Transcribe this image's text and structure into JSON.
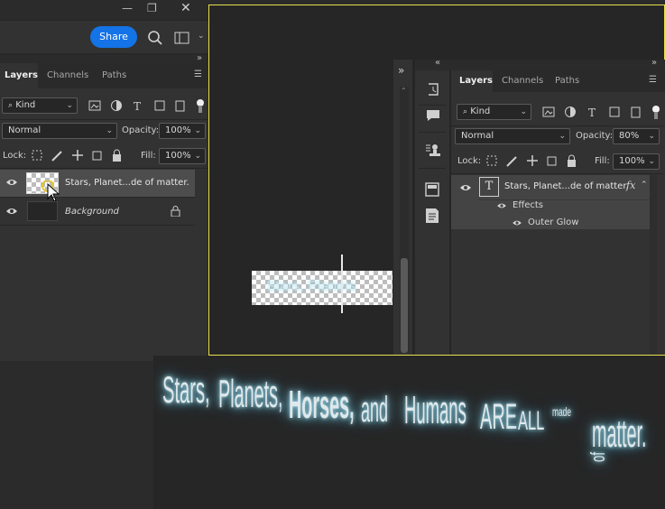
{
  "window": {
    "minimize": "—",
    "restore": "❐",
    "close": "✕"
  },
  "header": {
    "share_label": "Share"
  },
  "left_panel": {
    "tabs": [
      "Layers",
      "Channels",
      "Paths"
    ],
    "kind": "Kind",
    "blend_mode": "Normal",
    "opacity_label": "Opacity:",
    "opacity": "100%",
    "lock_label": "Lock:",
    "fill_label": "Fill:",
    "fill": "100%",
    "layers": [
      {
        "name": "Stars, Planet...de of matter."
      },
      {
        "name": "Background"
      }
    ]
  },
  "right_panel": {
    "tabs": [
      "Layers",
      "Channels",
      "Paths"
    ],
    "kind": "Kind",
    "blend_mode": "Normal",
    "opacity_label": "Opacity:",
    "opacity": "80%",
    "lock_label": "Lock:",
    "fill_label": "Fill:",
    "fill": "100%",
    "layer_name": "Stars, Planet...de of matter.",
    "fx": "fx",
    "effects_label": "Effects",
    "effect_item": "Outer Glow"
  },
  "canvas_preview": {
    "text": "Stars, Planets"
  },
  "glow_preview": {
    "w1": "Stars,",
    "w2": "Planets,",
    "w3": "Horses,",
    "w4": "and",
    "w5": "Humans",
    "w6": "ARE",
    "w7": "ALL",
    "w8": "made",
    "w9": "of",
    "w10": "matter."
  },
  "colors": {
    "accent": "#1473e6",
    "selection_border": "#e6e04a",
    "panel": "#323232",
    "canvas": "#262626"
  }
}
